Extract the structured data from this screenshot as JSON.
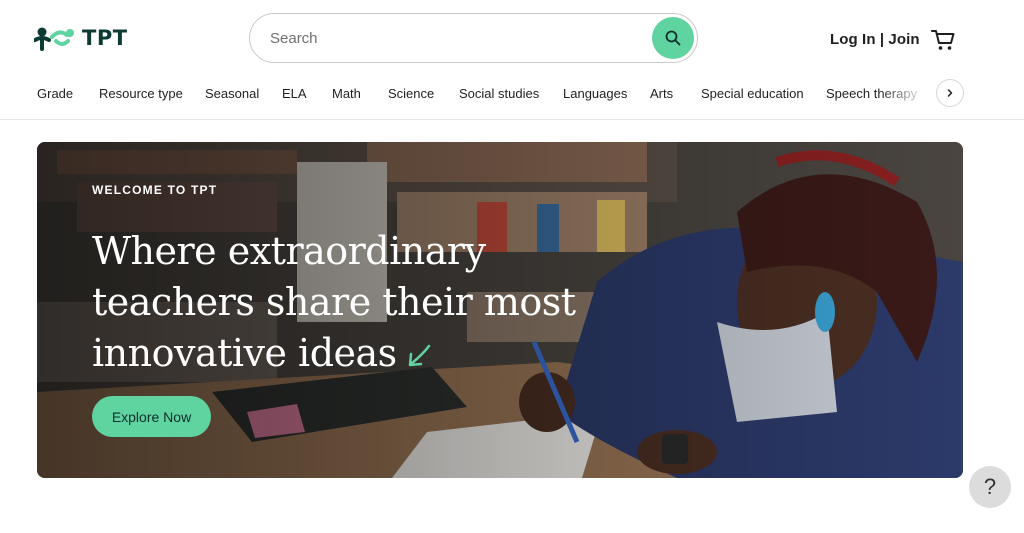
{
  "header": {
    "logo_text": "TPT",
    "search": {
      "placeholder": "Search"
    },
    "auth_label": "Log In | Join"
  },
  "nav": {
    "items": [
      "Grade",
      "Resource type",
      "Seasonal",
      "ELA",
      "Math",
      "Science",
      "Social studies",
      "Languages",
      "Arts",
      "Special education",
      "Speech therapy"
    ]
  },
  "hero": {
    "eyebrow": "WELCOME TO TPT",
    "title_lines": [
      "Where extraordinary",
      "teachers share their most",
      "innovative ideas"
    ],
    "cta_label": "Explore Now"
  },
  "help": {
    "label": "?"
  },
  "colors": {
    "brand_green": "#5fd3a0",
    "logo_dark": "#0e3a34",
    "text": "#1f1f1f"
  },
  "icons": {
    "logo": "tpt-logo-icon",
    "search": "search-icon",
    "cart": "cart-icon",
    "nav_next": "chevron-right-icon",
    "hero_arrow": "arrow-icon"
  }
}
